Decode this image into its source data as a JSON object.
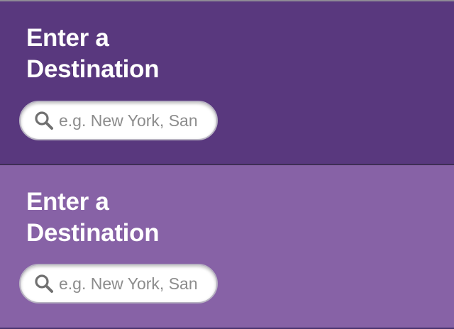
{
  "panels": [
    {
      "heading_line1": "Enter a",
      "heading_line2": "Destination",
      "search": {
        "placeholder": "e.g. New York, San",
        "value": "",
        "icon": "search-icon"
      },
      "background": "#59387e"
    },
    {
      "heading_line1": "Enter a",
      "heading_line2": "Destination",
      "search": {
        "placeholder": "e.g. New York, San",
        "value": "",
        "icon": "search-icon"
      },
      "background": "#8762a6"
    }
  ],
  "colors": {
    "text": "#ffffff",
    "icon": "#707070",
    "placeholder": "#8c8c8c"
  }
}
